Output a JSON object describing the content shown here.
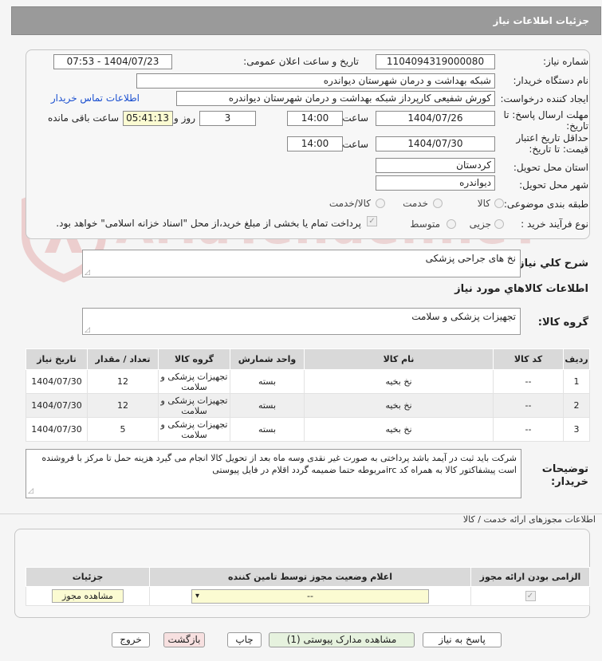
{
  "header": {
    "title": "جزئیات اطلاعات نیاز"
  },
  "form": {
    "need_number_label": "شماره نیاز:",
    "need_number": "1104094319000080",
    "announce_label": "تاریخ و ساعت اعلان عمومی:",
    "announce_value": "1404/07/23 - 07:53",
    "buyer_label": "نام دستگاه خریدار:",
    "buyer_value": "شبکه بهداشت و درمان شهرستان دیواندره",
    "creator_label": "ایجاد کننده درخواست:",
    "creator_value": "کورش شفیعی کارپرداز شبکه بهداشت و درمان شهرستان دیواندره",
    "contact_link": "اطلاعات تماس خریدار",
    "deadline_label_1": "مهلت ارسال پاسخ: تا",
    "deadline_label_2": "تاریخ:",
    "deadline_date": "1404/07/26",
    "time_label": "ساعت",
    "deadline_time": "14:00",
    "days_value": "3",
    "days_label": "روز و",
    "remaining_value": "05:41:13",
    "remaining_label": "ساعت باقی مانده",
    "validity_label_1": "حداقل تاریخ اعتبار",
    "validity_label_2": "قیمت: تا تاریخ:",
    "validity_date": "1404/07/30",
    "validity_time": "14:00",
    "province_label": "استان محل تحویل:",
    "province_value": "کردستان",
    "city_label": "شهر محل تحویل:",
    "city_value": "دیواندره",
    "category_label": "طبقه بندی موضوعی:",
    "category_options": [
      "کالا",
      "خدمت",
      "کالا/خدمت"
    ],
    "process_label": "نوع فرآیند خرید :",
    "process_options": [
      "جزیی",
      "متوسط"
    ],
    "payment_note": "پرداخت تمام یا بخشی از مبلغ خرید،از محل \"اسناد خزانه اسلامی\" خواهد بود."
  },
  "summary": {
    "label": "شرح کلي نياز:",
    "value": "نخ های جراحی پزشکی"
  },
  "goods_section": {
    "title": "اطلاعات كالاهاي مورد نياز",
    "group_label": "گروه کالا:",
    "group_value": "تجهیزات پزشکی و سلامت"
  },
  "goods_table": {
    "headers": [
      "ردیف",
      "کد کالا",
      "نام کالا",
      "واحد شمارش",
      "گروه کالا",
      "تعداد / مقدار",
      "تاریخ نیاز"
    ],
    "rows": [
      {
        "idx": "1",
        "code": "--",
        "name": "نخ بخیه",
        "unit": "بسته",
        "group": "تجهیزات پزشکی و سلامت",
        "qty": "12",
        "date": "1404/07/30"
      },
      {
        "idx": "2",
        "code": "--",
        "name": "نخ بخیه",
        "unit": "بسته",
        "group": "تجهیزات پزشکی و سلامت",
        "qty": "12",
        "date": "1404/07/30"
      },
      {
        "idx": "3",
        "code": "--",
        "name": "نخ بخیه",
        "unit": "بسته",
        "group": "تجهیزات پزشکی و سلامت",
        "qty": "5",
        "date": "1404/07/30"
      }
    ]
  },
  "buyer_notes": {
    "label_1": "توضیحات",
    "label_2": "خریدار:",
    "value": "شرکت باید ثبت در آیمد باشد پرداختی به صورت غیر نقدی وسه ماه بعد از تحویل کالا انجام می گیرد هزینه حمل تا مرکز با فروشنده است پیشفاکتور کالا به همراه کد ircمربوطه حتما ضمیمه گردد اقلام در فایل پیوستی"
  },
  "permits": {
    "title": "اطلاعات مجوزهای ارائه خدمت / کالا",
    "headers": [
      "الزامی بودن ارائه مجوز",
      "اعلام وضعیت مجوز توسط تامین کننده",
      "جزئیات"
    ],
    "select_value": "--",
    "view_button": "مشاهده مجوز"
  },
  "watermark": {
    "text": "AriaTender.neT"
  },
  "footer": {
    "reply": "پاسخ به نیاز",
    "attachments": "مشاهده مدارک پیوستی (1)",
    "print": "چاپ",
    "back": "بازگشت",
    "exit": "خروج"
  },
  "colors": {
    "header_bg": "#9a9a9a",
    "link": "#1a4fd0",
    "table_header_bg": "#d9d9d9",
    "watermark": "#e8b9b9",
    "attachments_btn": "#e6f2de",
    "back_btn": "#f7e0e0"
  }
}
